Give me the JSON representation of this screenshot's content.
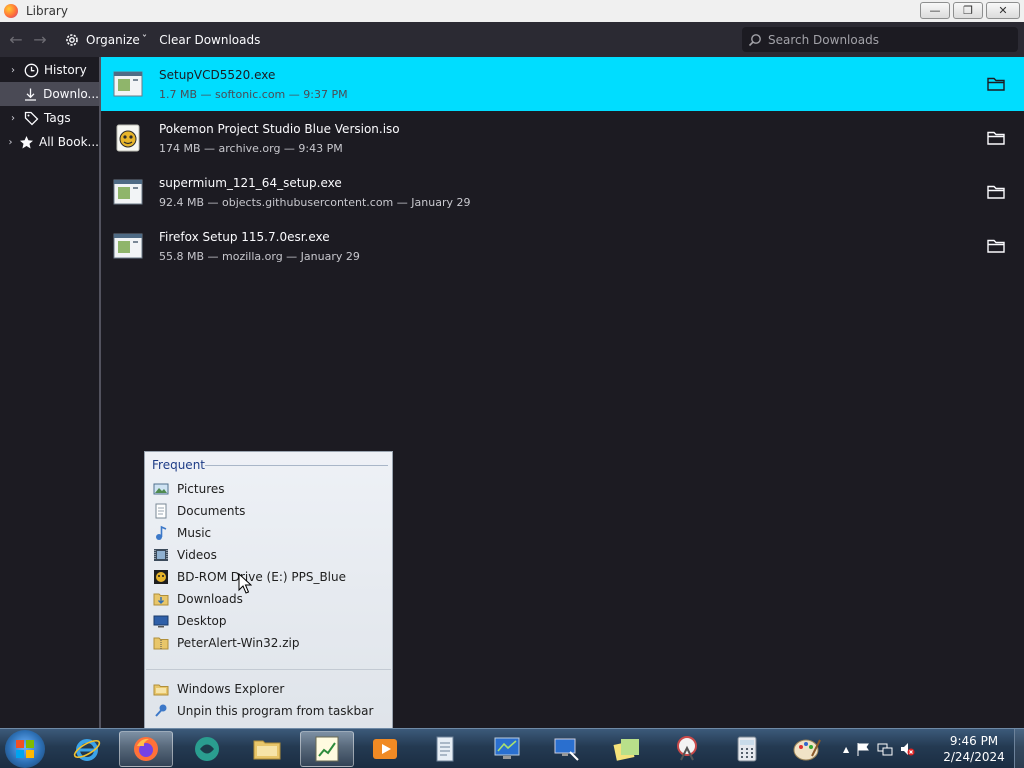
{
  "window": {
    "title": "Library",
    "minimize_glyph": "—",
    "restore_glyph": "❐",
    "close_glyph": "✕"
  },
  "toolbar": {
    "back_glyph": "←",
    "forward_glyph": "→",
    "organize_label": "Organize",
    "organize_caret": "ˇ",
    "clear_label": "Clear Downloads"
  },
  "search": {
    "placeholder": "Search Downloads",
    "value": ""
  },
  "sidebar": {
    "items": [
      {
        "label": "History",
        "icon": "clock-icon",
        "twisty": "›"
      },
      {
        "label": "Downlo...",
        "icon": "download-icon",
        "twisty": ""
      },
      {
        "label": "Tags",
        "icon": "tag-icon",
        "twisty": "›"
      },
      {
        "label": "All Book...",
        "icon": "star-icon",
        "twisty": "›"
      }
    ],
    "selected_index": 1
  },
  "downloads": [
    {
      "name": "SetupVCD5520.exe",
      "meta": "1.7 MB — softonic.com — 9:37 PM",
      "icon": "exe-file-icon",
      "selected": true
    },
    {
      "name": "Pokemon Project Studio Blue Version.iso",
      "meta": "174 MB — archive.org — 9:43 PM",
      "icon": "pokemon-iso-icon",
      "selected": false
    },
    {
      "name": "supermium_121_64_setup.exe",
      "meta": "92.4 MB — objects.githubusercontent.com — January 29",
      "icon": "exe-file-icon",
      "selected": false
    },
    {
      "name": "Firefox Setup 115.7.0esr.exe",
      "meta": "55.8 MB — mozilla.org — January 29",
      "icon": "exe-file-icon",
      "selected": false
    }
  ],
  "jumplist": {
    "header": "Frequent",
    "items": [
      {
        "label": "Pictures",
        "icon": "pictures-icon"
      },
      {
        "label": "Documents",
        "icon": "documents-icon"
      },
      {
        "label": "Music",
        "icon": "music-icon"
      },
      {
        "label": "Videos",
        "icon": "videos-icon"
      },
      {
        "label": "BD-ROM Drive (E:) PPS_Blue",
        "icon": "bd-rom-drive-icon"
      },
      {
        "label": "Downloads",
        "icon": "downloads-folder-icon"
      },
      {
        "label": "Desktop",
        "icon": "desktop-icon"
      },
      {
        "label": "PeterAlert-Win32.zip",
        "icon": "zip-file-icon"
      }
    ],
    "tasks": [
      {
        "label": "Windows Explorer",
        "icon": "windows-explorer-icon"
      },
      {
        "label": "Unpin this program from taskbar",
        "icon": "unpin-icon"
      }
    ]
  },
  "taskbar": {
    "apps": [
      {
        "name": "internet-explorer-icon",
        "active": false
      },
      {
        "name": "firefox-icon",
        "active": true
      },
      {
        "name": "teal-app-icon",
        "active": false
      },
      {
        "name": "windows-explorer-icon",
        "active": false
      },
      {
        "name": "notepad-chart-icon",
        "active": true
      },
      {
        "name": "media-player-icon",
        "active": false
      },
      {
        "name": "document-viewer-icon",
        "active": false
      },
      {
        "name": "monitor-icon",
        "active": false
      },
      {
        "name": "remote-desktop-icon",
        "active": false
      },
      {
        "name": "sticky-notes-icon",
        "active": false
      },
      {
        "name": "snipping-tool-icon",
        "active": false
      },
      {
        "name": "calculator-icon",
        "active": false
      },
      {
        "name": "paint-icon",
        "active": false
      }
    ],
    "tray_chevron": "▲",
    "time": "9:46 PM",
    "date": "2/24/2024"
  },
  "colors": {
    "selection": "#00ddff",
    "background": "#1c1b22",
    "toolbar": "#2b2a33"
  }
}
